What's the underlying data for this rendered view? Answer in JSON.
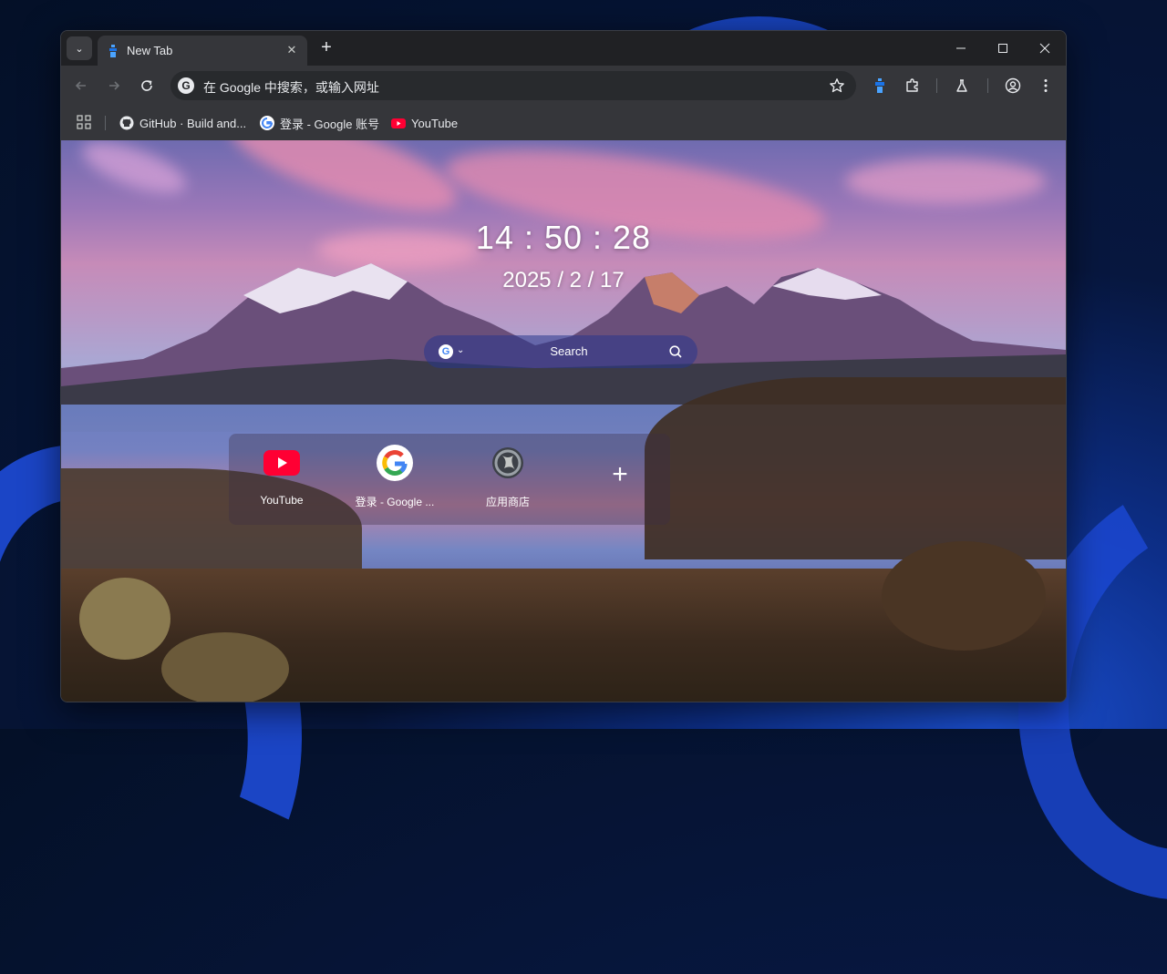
{
  "window": {
    "tab_title": "New Tab",
    "tab_close_glyph": "✕",
    "new_tab_glyph": "+",
    "tab_list_glyph": "⌄",
    "controls": [
      "minimize",
      "maximize",
      "close"
    ]
  },
  "toolbar": {
    "omnibox_text": "在 Google 中搜索，或输入网址",
    "omnibox_engine_glyph": "G"
  },
  "bookmarks": [
    {
      "label": "GitHub · Build and...",
      "icon": "github-icon"
    },
    {
      "label": "登录 - Google 账号",
      "icon": "google-icon"
    },
    {
      "label": "YouTube",
      "icon": "youtube-icon"
    }
  ],
  "newtab": {
    "time": "14 : 50 : 28",
    "date": "2025 / 2 / 17",
    "search": {
      "label": "Search",
      "engine_glyph": "G",
      "caret": "⌄"
    },
    "shortcuts": [
      {
        "label": "YouTube",
        "icon": "youtube-icon"
      },
      {
        "label": "登录 - Google ...",
        "icon": "google-icon"
      },
      {
        "label": "应用商店",
        "icon": "web-store-icon"
      }
    ],
    "add_glyph": "+"
  },
  "colors": {
    "frame": "#202124",
    "toolbar": "#35363a",
    "omnibox": "#282a2d",
    "text": "#e8eaed",
    "extension_accent": "#1a73e8",
    "youtube_red": "#ff0033"
  }
}
